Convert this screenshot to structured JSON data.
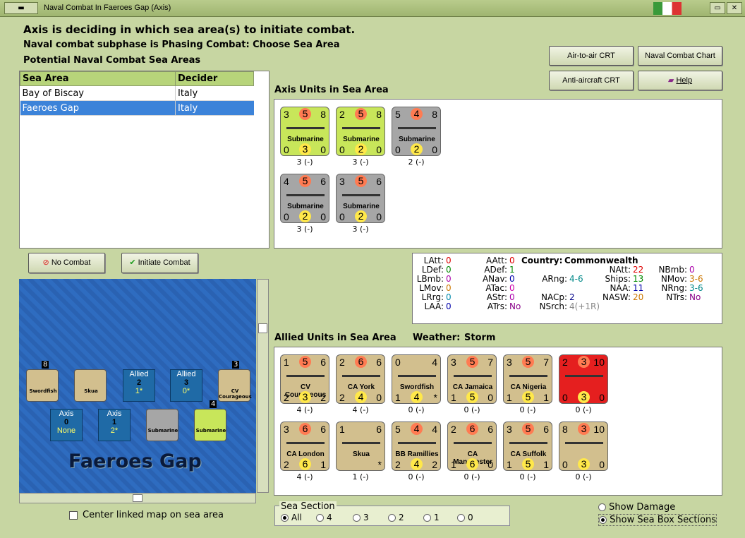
{
  "window": {
    "title": "Naval Combat In Faeroes Gap (Axis)"
  },
  "header": {
    "line1": "Axis is deciding in which sea area(s) to initiate combat.",
    "line2": "Naval combat subphase is Phasing Combat: Choose Sea Area",
    "line3": "Potential Naval Combat Sea Areas"
  },
  "buttons": {
    "air_crt": "Air-to-air CRT",
    "naval_chart": "Naval Combat Chart",
    "aa_crt": "Anti-aircraft CRT",
    "help": "Help",
    "no_combat": "No Combat",
    "initiate": "Initiate Combat"
  },
  "sea_table": {
    "headers": [
      "Sea Area",
      "Decider"
    ],
    "rows": [
      [
        "Bay of Biscay",
        "Italy"
      ],
      [
        "Faeroes Gap",
        "Italy"
      ]
    ],
    "selected": 1
  },
  "axis": {
    "title": "Axis Units in Sea Area",
    "units": [
      {
        "a": "3",
        "b": "5",
        "c": "8",
        "name": "Submarine",
        "d": "0",
        "e": "3",
        "f": "0",
        "label": "3 (-)",
        "color": "#c8e65a"
      },
      {
        "a": "2",
        "b": "5",
        "c": "8",
        "name": "Submarine",
        "d": "0",
        "e": "2",
        "f": "0",
        "label": "3 (-)",
        "color": "#c8e65a"
      },
      {
        "a": "5",
        "b": "4",
        "c": "8",
        "name": "Submarine",
        "d": "0",
        "e": "2",
        "f": "0",
        "label": "2 (-)",
        "color": "#a6a6a6"
      },
      {
        "a": "4",
        "b": "5",
        "c": "6",
        "name": "Submarine",
        "d": "0",
        "e": "2",
        "f": "0",
        "label": "3 (-)",
        "color": "#a6a6a6"
      },
      {
        "a": "3",
        "b": "5",
        "c": "6",
        "name": "Submarine",
        "d": "0",
        "e": "2",
        "f": "0",
        "label": "3 (-)",
        "color": "#a6a6a6"
      }
    ]
  },
  "country": {
    "label": "Country:",
    "name": "Commonwealth",
    "stats": [
      [
        "LAtt:",
        "0",
        "#d00"
      ],
      [
        "LDef:",
        "0",
        "#080"
      ],
      [
        "LBmb:",
        "0",
        "#a0a"
      ],
      [
        "LMov:",
        "0",
        "#c70"
      ],
      [
        "LRrg:",
        "0",
        "#08a"
      ],
      [
        "LAA:",
        "0",
        "#00a"
      ],
      [
        "AAtt:",
        "0",
        "#d00"
      ],
      [
        "ADef:",
        "1",
        "#080"
      ],
      [
        "ANav:",
        "0",
        "#00a"
      ],
      [
        "ATac:",
        "0",
        "#c0a"
      ],
      [
        "AStr:",
        "0",
        "#a0a"
      ],
      [
        "ATrs:",
        "No",
        "#808"
      ],
      [
        "ARng:",
        "4-6",
        "#088"
      ],
      [
        "NACp:",
        "2",
        "#008"
      ],
      [
        "NSrch:",
        "4(+1R)",
        "#888"
      ],
      [
        "NAtt:",
        "22",
        "#d00"
      ],
      [
        "Ships:",
        "13",
        "#080"
      ],
      [
        "NAA:",
        "11",
        "#00a"
      ],
      [
        "NASW:",
        "20",
        "#c70"
      ],
      [
        "NBmb:",
        "0",
        "#a0a"
      ],
      [
        "NMov:",
        "3-6",
        "#c70"
      ],
      [
        "NRng:",
        "3-6",
        "#088"
      ],
      [
        "NTrs:",
        "No",
        "#808"
      ]
    ]
  },
  "allied": {
    "title": "Allied Units in Sea Area",
    "weather_label": "Weather:",
    "weather": "Storm",
    "units": [
      {
        "a": "1",
        "b": "5",
        "c": "6",
        "name": "CV Courageous",
        "d": "2",
        "e": "3",
        "f": "2",
        "label": "4 (-)",
        "color": "#d2bf8e"
      },
      {
        "a": "2",
        "b": "6",
        "c": "6",
        "name": "CA York",
        "d": "2",
        "e": "4",
        "f": "0",
        "label": "4 (-)",
        "color": "#d2bf8e"
      },
      {
        "a": "0",
        "b": "",
        "c": "4",
        "name": "Swordfish",
        "d": "1",
        "e": "4",
        "f": "*",
        "label": "0 (-)",
        "color": "#d2bf8e"
      },
      {
        "a": "3",
        "b": "5",
        "c": "7",
        "name": "CA Jamaica",
        "d": "1",
        "e": "5",
        "f": "0",
        "label": "0 (-)",
        "color": "#d2bf8e"
      },
      {
        "a": "3",
        "b": "5",
        "c": "7",
        "name": "CA Nigeria",
        "d": "1",
        "e": "5",
        "f": "1",
        "label": "0 (-)",
        "color": "#d2bf8e"
      },
      {
        "a": "2",
        "b": "3",
        "c": "10",
        "name": "",
        "d": "0",
        "e": "3",
        "f": "0",
        "label": "0 (-)",
        "color": "#e51f1f"
      },
      {
        "a": "3",
        "b": "6",
        "c": "6",
        "name": "CA London",
        "d": "2",
        "e": "6",
        "f": "1",
        "label": "4 (-)",
        "color": "#d2bf8e"
      },
      {
        "a": "1",
        "b": "",
        "c": "6",
        "name": "Skua",
        "d": "",
        "e": "",
        "f": "*",
        "label": "1 (-)",
        "color": "#d2bf8e"
      },
      {
        "a": "5",
        "b": "4",
        "c": "4",
        "name": "BB Ramillies",
        "d": "2",
        "e": "4",
        "f": "2",
        "label": "0 (-)",
        "color": "#d2bf8e"
      },
      {
        "a": "2",
        "b": "6",
        "c": "6",
        "name": "CA Manchester",
        "d": "1",
        "e": "6",
        "f": "0",
        "label": "0 (-)",
        "color": "#d2bf8e"
      },
      {
        "a": "3",
        "b": "5",
        "c": "6",
        "name": "CA Suffolk",
        "d": "1",
        "e": "5",
        "f": "1",
        "label": "0 (-)",
        "color": "#d2bf8e"
      },
      {
        "a": "8",
        "b": "3",
        "c": "10",
        "name": "",
        "d": "0",
        "e": "3",
        "f": "0",
        "label": "0 (-)",
        "color": "#d2bf8e"
      }
    ]
  },
  "map": {
    "title": "Faeroes Gap",
    "boxes": [
      {
        "side": "Allied",
        "num": "2",
        "sub": "1*"
      },
      {
        "side": "Allied",
        "num": "3",
        "sub": "0*"
      },
      {
        "side": "Axis",
        "num": "0",
        "sub": "None"
      },
      {
        "side": "Axis",
        "num": "1",
        "sub": "2*"
      }
    ],
    "counters": [
      "Swordfish",
      "Skua",
      "CV Courageous",
      "Submarine",
      "Submarine"
    ],
    "stack_nums": [
      "8",
      "3",
      "4"
    ]
  },
  "center_map": "Center linked map on sea area",
  "sea_section": {
    "title": "Sea Section",
    "options": [
      "All",
      "4",
      "3",
      "2",
      "1",
      "0"
    ],
    "selected": "All"
  },
  "options": {
    "show_damage": "Show Damage",
    "show_sections": "Show Sea Box Sections"
  }
}
